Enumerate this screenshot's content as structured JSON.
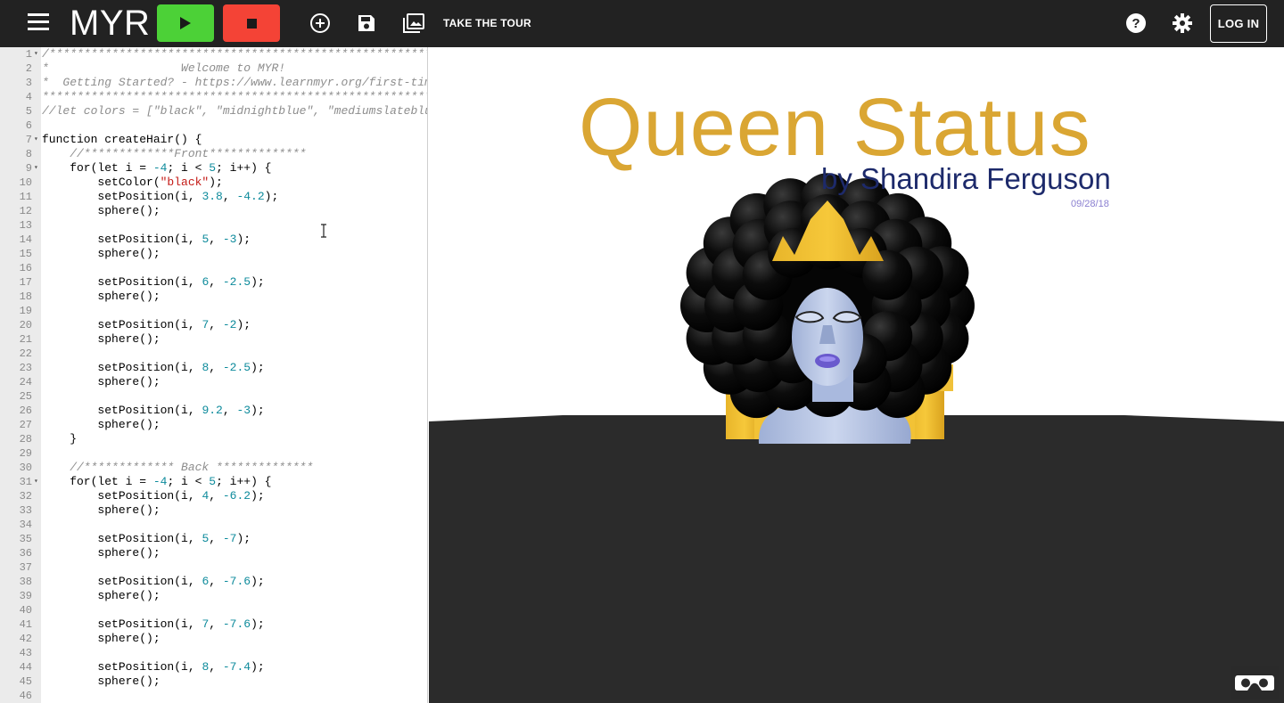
{
  "header": {
    "brand": "MYR",
    "menu_icon": "hamburger-menu-icon",
    "play_icon": "play-icon",
    "stop_icon": "stop-icon",
    "new_icon": "add-circle-icon",
    "save_icon": "save-icon",
    "gallery_icon": "photo-library-icon",
    "tour_label": "TAKE THE TOUR",
    "help_icon": "help-circle-icon",
    "settings_icon": "gear-icon",
    "login_label": "LOG IN",
    "colors": {
      "bar": "#222222",
      "play": "#4cd137",
      "stop": "#f44336"
    }
  },
  "editor": {
    "lines": [
      {
        "n": "1",
        "fold": true,
        "text": "/*********************************************************",
        "kind": "comment"
      },
      {
        "n": "2",
        "fold": false,
        "text": "*                   Welcome to MYR!                     *",
        "kind": "comment"
      },
      {
        "n": "3",
        "fold": false,
        "text": "*  Getting Started? - https://www.learnmyr.org/first-time *",
        "kind": "comment"
      },
      {
        "n": "4",
        "fold": false,
        "text": "*********************************************************/",
        "kind": "comment"
      },
      {
        "n": "5",
        "fold": false,
        "text": "//let colors = [\"black\", \"midnightblue\", \"mediumslateblue\",",
        "kind": "comment"
      },
      {
        "n": "6",
        "fold": false,
        "text": "",
        "kind": "code"
      },
      {
        "n": "7",
        "fold": true,
        "text": "function createHair() {",
        "kind": "code"
      },
      {
        "n": "8",
        "fold": false,
        "text": "    //*************Front**************",
        "kind": "comment"
      },
      {
        "n": "9",
        "fold": true,
        "text": "    for(let i = -4; i < 5; i++) {",
        "kind": "code"
      },
      {
        "n": "10",
        "fold": false,
        "text": "        setColor(\"black\");",
        "kind": "code"
      },
      {
        "n": "11",
        "fold": false,
        "text": "        setPosition(i, 3.8, -4.2);",
        "kind": "code"
      },
      {
        "n": "12",
        "fold": false,
        "text": "        sphere();",
        "kind": "code"
      },
      {
        "n": "13",
        "fold": false,
        "text": "",
        "kind": "code"
      },
      {
        "n": "14",
        "fold": false,
        "text": "        setPosition(i, 5, -3);",
        "kind": "code"
      },
      {
        "n": "15",
        "fold": false,
        "text": "        sphere();",
        "kind": "code"
      },
      {
        "n": "16",
        "fold": false,
        "text": "",
        "kind": "code"
      },
      {
        "n": "17",
        "fold": false,
        "text": "        setPosition(i, 6, -2.5);",
        "kind": "code"
      },
      {
        "n": "18",
        "fold": false,
        "text": "        sphere();",
        "kind": "code"
      },
      {
        "n": "19",
        "fold": false,
        "text": "",
        "kind": "code"
      },
      {
        "n": "20",
        "fold": false,
        "text": "        setPosition(i, 7, -2);",
        "kind": "code"
      },
      {
        "n": "21",
        "fold": false,
        "text": "        sphere();",
        "kind": "code"
      },
      {
        "n": "22",
        "fold": false,
        "text": "",
        "kind": "code"
      },
      {
        "n": "23",
        "fold": false,
        "text": "        setPosition(i, 8, -2.5);",
        "kind": "code"
      },
      {
        "n": "24",
        "fold": false,
        "text": "        sphere();",
        "kind": "code"
      },
      {
        "n": "25",
        "fold": false,
        "text": "",
        "kind": "code"
      },
      {
        "n": "26",
        "fold": false,
        "text": "        setPosition(i, 9.2, -3);",
        "kind": "code"
      },
      {
        "n": "27",
        "fold": false,
        "text": "        sphere();",
        "kind": "code"
      },
      {
        "n": "28",
        "fold": false,
        "text": "    }",
        "kind": "code"
      },
      {
        "n": "29",
        "fold": false,
        "text": "",
        "kind": "code"
      },
      {
        "n": "30",
        "fold": false,
        "text": "    //************* Back **************",
        "kind": "comment"
      },
      {
        "n": "31",
        "fold": true,
        "text": "    for(let i = -4; i < 5; i++) {",
        "kind": "code"
      },
      {
        "n": "32",
        "fold": false,
        "text": "        setPosition(i, 4, -6.2);",
        "kind": "code"
      },
      {
        "n": "33",
        "fold": false,
        "text": "        sphere();",
        "kind": "code"
      },
      {
        "n": "34",
        "fold": false,
        "text": "",
        "kind": "code"
      },
      {
        "n": "35",
        "fold": false,
        "text": "        setPosition(i, 5, -7);",
        "kind": "code"
      },
      {
        "n": "36",
        "fold": false,
        "text": "        sphere();",
        "kind": "code"
      },
      {
        "n": "37",
        "fold": false,
        "text": "",
        "kind": "code"
      },
      {
        "n": "38",
        "fold": false,
        "text": "        setPosition(i, 6, -7.6);",
        "kind": "code"
      },
      {
        "n": "39",
        "fold": false,
        "text": "        sphere();",
        "kind": "code"
      },
      {
        "n": "40",
        "fold": false,
        "text": "",
        "kind": "code"
      },
      {
        "n": "41",
        "fold": false,
        "text": "        setPosition(i, 7, -7.6);",
        "kind": "code"
      },
      {
        "n": "42",
        "fold": false,
        "text": "        sphere();",
        "kind": "code"
      },
      {
        "n": "43",
        "fold": false,
        "text": "",
        "kind": "code"
      },
      {
        "n": "44",
        "fold": false,
        "text": "        setPosition(i, 8, -7.4);",
        "kind": "code"
      },
      {
        "n": "45",
        "fold": false,
        "text": "        sphere();",
        "kind": "code"
      },
      {
        "n": "46",
        "fold": false,
        "text": "",
        "kind": "code"
      }
    ],
    "colors": {
      "number": "#0e8b9c",
      "string": "#c41a16",
      "comment": "#8d8d8d"
    }
  },
  "scene": {
    "title": "Queen Status",
    "author": "by Shandira Ferguson",
    "date": "09/28/18",
    "vr_icon": "vr-headset-icon",
    "colors": {
      "title": "#daa633",
      "author": "#1d2a6b",
      "floor": "#2b2b2b",
      "crown": "#f5c42c",
      "skin": "#b6c4e4",
      "lips": "#6a5acd"
    }
  }
}
